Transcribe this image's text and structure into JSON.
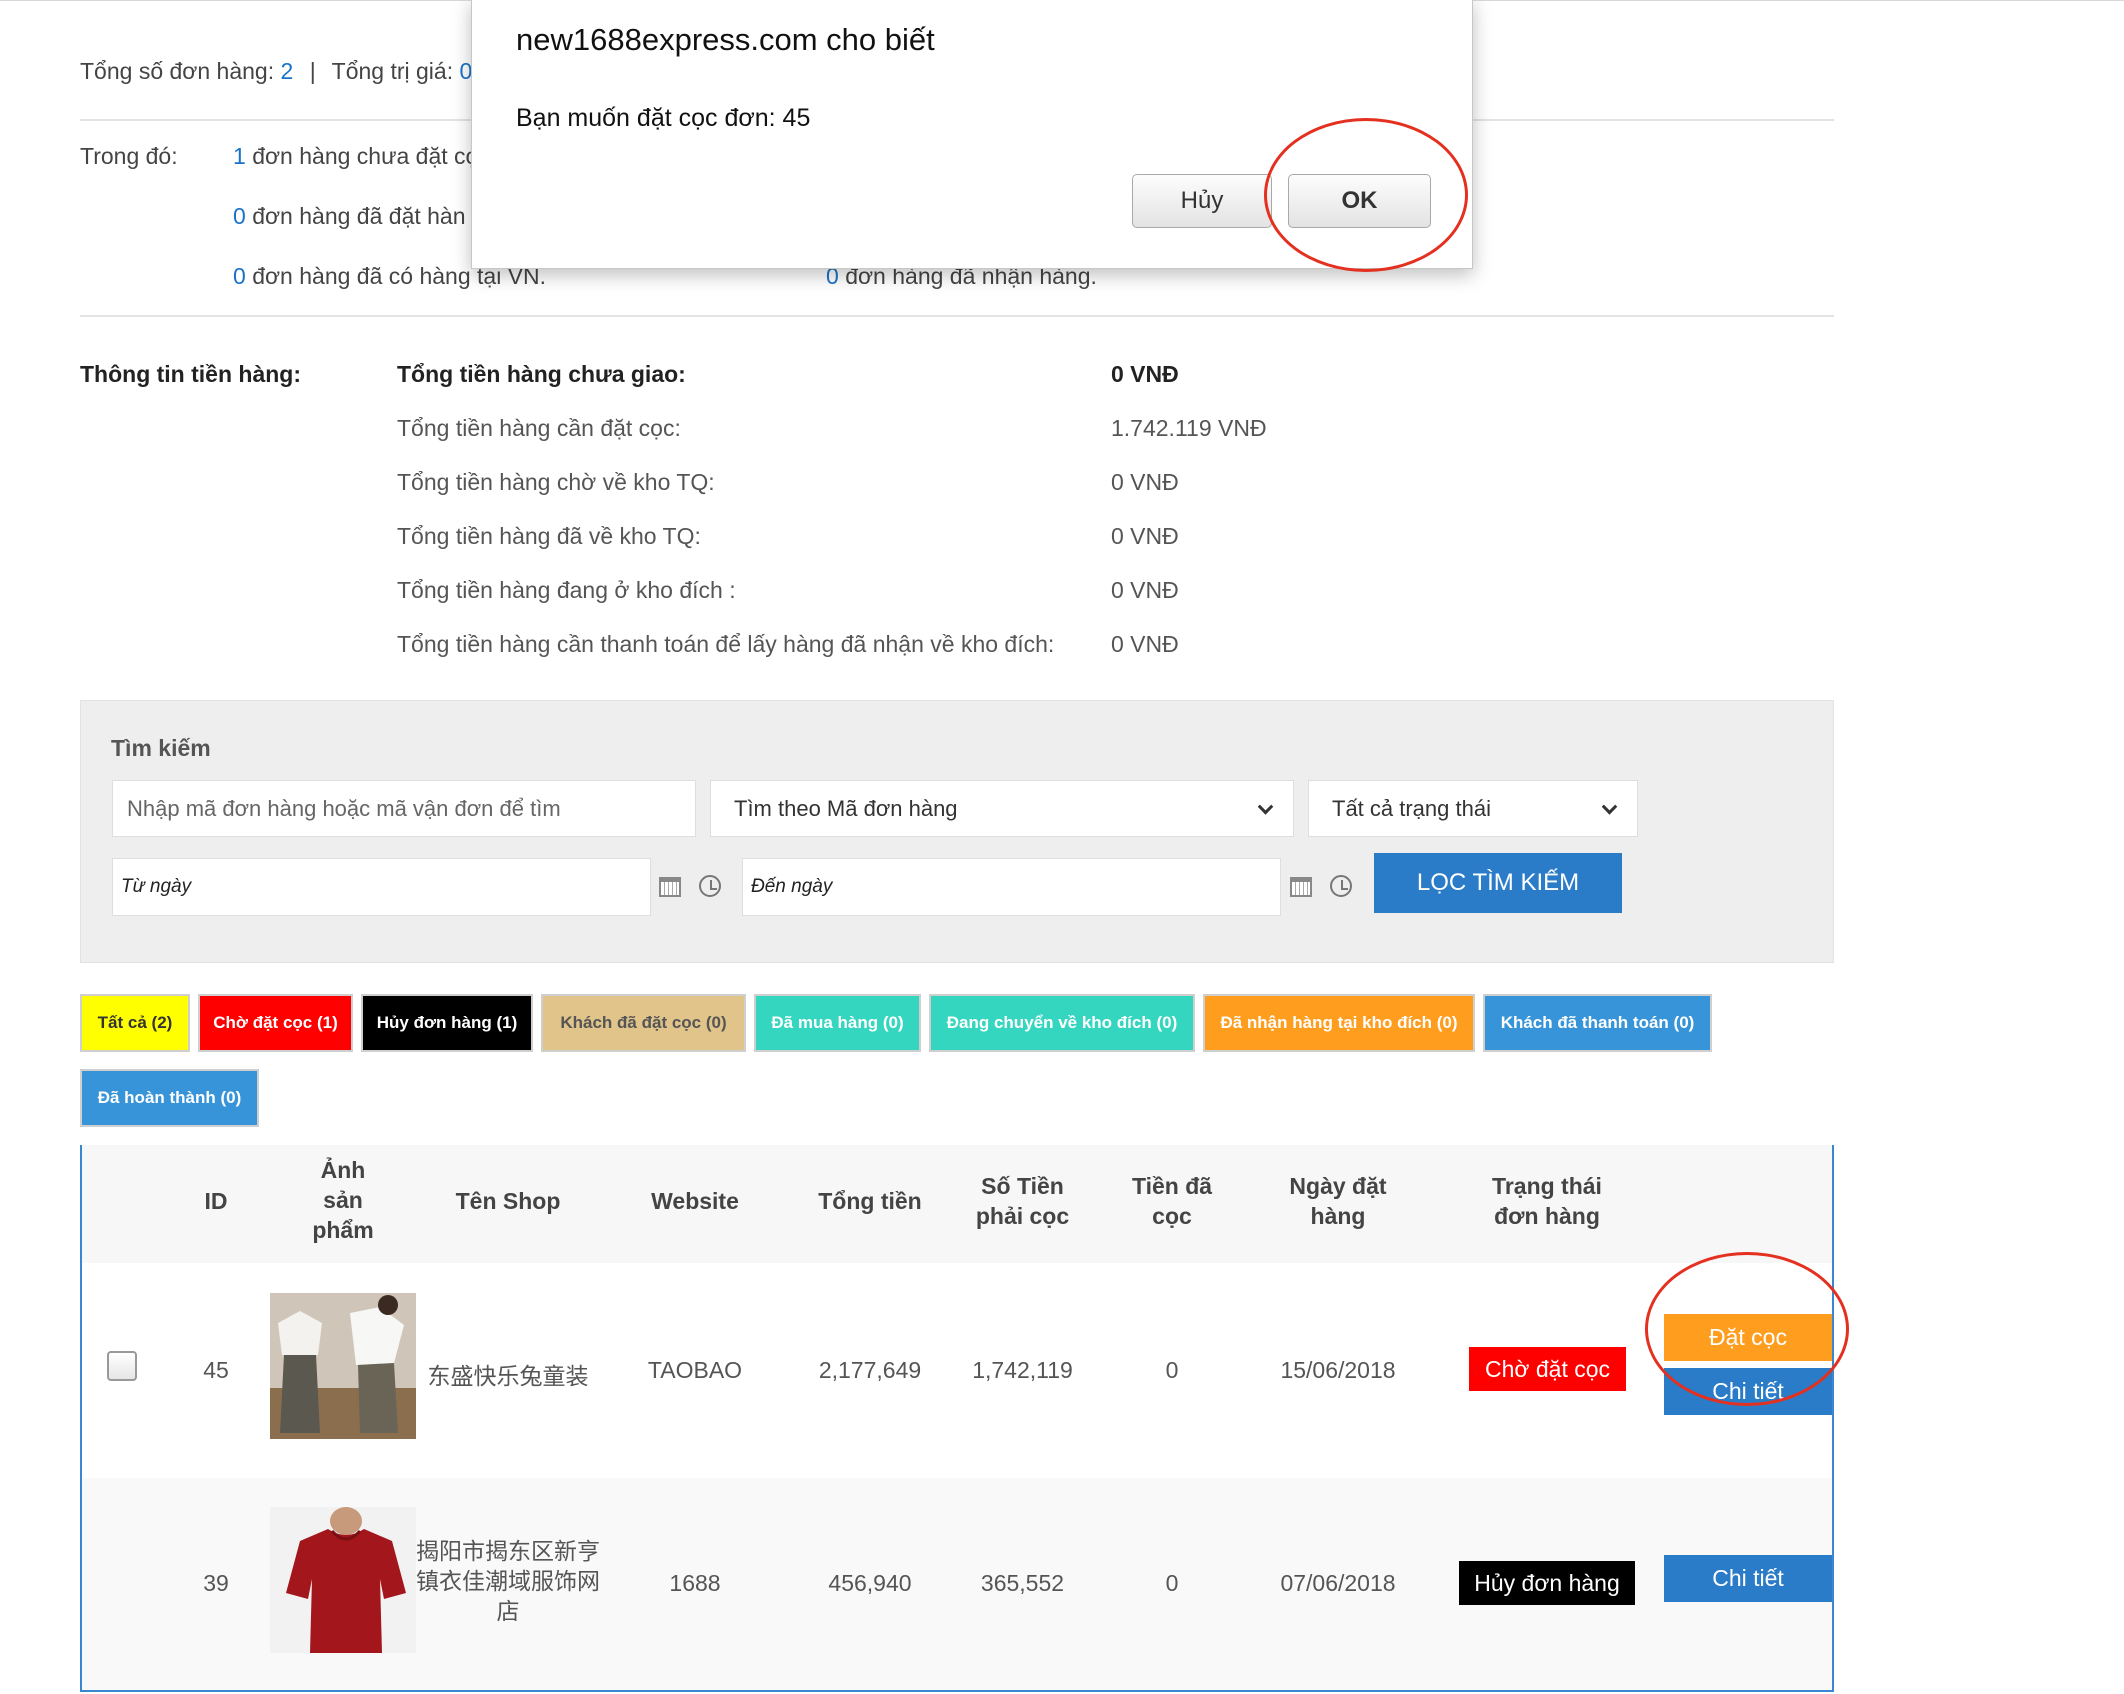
{
  "summary": {
    "total_orders_label": "Tổng số đơn hàng:",
    "total_orders_value": "2",
    "separator": "|",
    "total_value_label": "Tổng trị giá:",
    "total_value_partial": "0",
    "of_which_label": "Trong đó:",
    "lines": [
      {
        "count": "1",
        "text": "đơn hàng chưa đặt cọ"
      },
      {
        "count": "0",
        "text": "đơn hàng đã đặt hàn"
      },
      {
        "count": "0",
        "text": "đơn hàng đã có hàng tại VN."
      }
    ],
    "received_count": "0",
    "received_text": "đơn hàng đã nhận hàng."
  },
  "money_info": {
    "section_label": "Thông tin tiền hàng:",
    "rows": [
      {
        "label": "Tổng tiền hàng chưa giao:",
        "value": "0 VNĐ"
      },
      {
        "label": "Tổng tiền hàng cần đặt cọc:",
        "value": "1.742.119 VNĐ"
      },
      {
        "label": "Tổng tiền hàng chờ về kho TQ:",
        "value": "0 VNĐ"
      },
      {
        "label": "Tổng tiền hàng đã về kho TQ:",
        "value": "0 VNĐ"
      },
      {
        "label": "Tổng tiền hàng đang ở kho đích :",
        "value": "0 VNĐ"
      },
      {
        "label": "Tổng tiền hàng cần thanh toán để lấy hàng đã nhận về kho đích:",
        "value": "0 VNĐ"
      }
    ]
  },
  "search": {
    "title": "Tìm kiếm",
    "keyword_placeholder": "Nhập mã đơn hàng hoặc mã vận đơn để tìm",
    "search_by_selected": "Tìm theo Mã đơn hàng",
    "status_selected": "Tất cả trạng thái",
    "from_date_placeholder": "Từ ngày",
    "to_date_placeholder": "Đến ngày",
    "filter_button": "LỌC TÌM KIẾM"
  },
  "status_tabs": [
    {
      "label": "Tất cả (2)",
      "bg": "#ffff00",
      "fg": "#333333"
    },
    {
      "label": "Chờ đặt cọc (1)",
      "bg": "#ff0000",
      "fg": "#ffffff"
    },
    {
      "label": "Hủy đơn hàng (1)",
      "bg": "#000000",
      "fg": "#ffffff"
    },
    {
      "label": "Khách đã đặt cọc (0)",
      "bg": "#e0c48a",
      "fg": "#555555"
    },
    {
      "label": "Đã mua hàng (0)",
      "bg": "#35d6c0",
      "fg": "#ffffff"
    },
    {
      "label": "Đang chuyển về kho đích (0)",
      "bg": "#35d6c0",
      "fg": "#ffffff"
    },
    {
      "label": "Đã nhận hàng tại kho đích (0)",
      "bg": "#ff9d1f",
      "fg": "#ffffff"
    },
    {
      "label": "Khách đã thanh toán (0)",
      "bg": "#3794d9",
      "fg": "#ffffff"
    },
    {
      "label": "Đã hoàn thành (0)",
      "bg": "#3794d9",
      "fg": "#ffffff"
    }
  ],
  "table": {
    "headers": {
      "id": "ID",
      "image": [
        "Ảnh",
        "sản",
        "phẩm"
      ],
      "shop": "Tên Shop",
      "website": "Website",
      "total": "Tổng tiền",
      "deposit_required": [
        "Số Tiền",
        "phải cọc"
      ],
      "deposited": [
        "Tiền đã",
        "cọc"
      ],
      "order_date": [
        "Ngày đặt",
        "hàng"
      ],
      "status": [
        "Trạng thái",
        "đơn hàng"
      ]
    },
    "rows": [
      {
        "id": "45",
        "shop": "东盛快乐兔童装",
        "website": "TAOBAO",
        "total": "2,177,649",
        "deposit_required": "1,742,119",
        "deposited": "0",
        "order_date": "15/06/2018",
        "status": "Chờ đặt cọc",
        "status_color": "#ff0000",
        "deposit_button": "Đặt cọc",
        "detail_button": "Chi tiết"
      },
      {
        "id": "39",
        "shop": [
          "揭阳市揭东区新亨",
          "镇衣佳潮域服饰网",
          "店"
        ],
        "website": "1688",
        "total": "456,940",
        "deposit_required": "365,552",
        "deposited": "0",
        "order_date": "07/06/2018",
        "status": "Hủy đơn hàng",
        "status_color": "#000000",
        "detail_button": "Chi tiết"
      }
    ]
  },
  "dialog": {
    "title": "new1688express.com cho biết",
    "message": "Bạn muốn đặt cọc đơn: 45",
    "cancel_button": "Hủy",
    "ok_button": "OK"
  },
  "colors": {
    "link_blue": "#1a73c9",
    "primary_button": "#2b7cc8",
    "deposit_button": "#ff9d1f",
    "annotation_circle": "#e4301f"
  }
}
